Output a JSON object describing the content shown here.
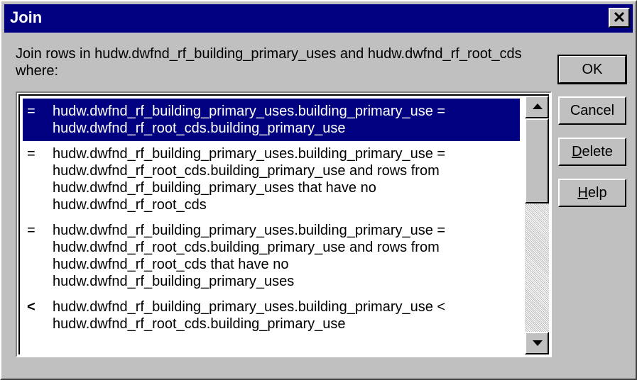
{
  "window": {
    "title": "Join",
    "close_label": "✕"
  },
  "instruction": "Join rows in hudw.dwfnd_rf_building_primary_uses and hudw.dwfnd_rf_root_cds where:",
  "join_list": [
    {
      "op": "=",
      "text": "hudw.dwfnd_rf_building_primary_uses.building_primary_use = hudw.dwfnd_rf_root_cds.building_primary_use",
      "selected": true
    },
    {
      "op": "=",
      "text": "hudw.dwfnd_rf_building_primary_uses.building_primary_use = hudw.dwfnd_rf_root_cds.building_primary_use and rows from hudw.dwfnd_rf_building_primary_uses that have no hudw.dwfnd_rf_root_cds",
      "selected": false
    },
    {
      "op": "=",
      "text": "hudw.dwfnd_rf_building_primary_uses.building_primary_use = hudw.dwfnd_rf_root_cds.building_primary_use and rows from hudw.dwfnd_rf_root_cds that have no hudw.dwfnd_rf_building_primary_uses",
      "selected": false
    },
    {
      "op": "<",
      "text": "hudw.dwfnd_rf_building_primary_uses.building_primary_use < hudw.dwfnd_rf_root_cds.building_primary_use",
      "selected": false
    }
  ],
  "buttons": {
    "ok": "OK",
    "cancel": "Cancel",
    "delete_mnemonic": "D",
    "delete_rest": "elete",
    "help_mnemonic": "H",
    "help_rest": "elp"
  },
  "colors": {
    "titlebar": "#000080",
    "selection": "#000080",
    "face": "#c0c0c0"
  }
}
